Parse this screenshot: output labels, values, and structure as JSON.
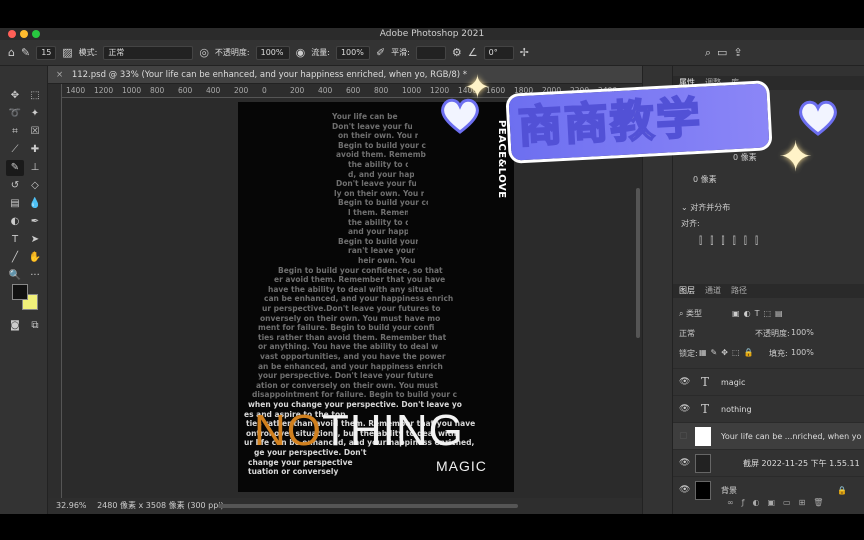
{
  "app": {
    "title": "Adobe Photoshop 2021"
  },
  "options_bar": {
    "brush_size": "15",
    "mode_label": "模式:",
    "mode_value": "正常",
    "opacity_label": "不透明度:",
    "opacity_value": "100%",
    "flow_label": "流量:",
    "flow_value": "100%",
    "smoothing_label": "平滑:",
    "angle_value": "0°"
  },
  "document": {
    "tab_title": "112.psd @ 33% (Your life can be enhanced, and your happiness enriched, when yo, RGB/8) *",
    "ruler_labels": [
      "1400",
      "1200",
      "1000",
      "800",
      "600",
      "400",
      "200",
      "0",
      "200",
      "400",
      "600",
      "800",
      "1000",
      "1200",
      "1400",
      "1600",
      "1800",
      "2000",
      "2200",
      "2400"
    ],
    "zoom": "32.96%",
    "doc_info": "2480 像素 x 3508 像素 (300 ppi)"
  },
  "artwork": {
    "vertical_text": "PEACE&LOVE",
    "headline_highlight": "NO",
    "headline_rest": "THING",
    "subline": "MAGIC",
    "body_lines": [
      "Your life can be",
      "Don't leave your futur",
      "on their own. You mus",
      "Begin to build your con",
      "avoid them. Remember th",
      "the ability to deal",
      "d, and your happine",
      "Don't leave your futu",
      "ly on their own. You mu",
      "Begin to build your con",
      "l them. Remember",
      "the ability to deal",
      "and your happine",
      "Begin to build your c",
      "ran't leave your fu",
      "heir own. You m",
      "Begin to build your confidence, so that ",
      "er avoid them. Remember that you have",
      "have the ability to deal with any situat",
      "can be enhanced, and your happiness enrich",
      "ur perspective.Don't leave your futures to",
      "onversely on their own. You must have mo",
      "ment for failure. Begin to build your confi",
      "ties rather than avoid them. Remember that",
      "or anything. You have the ability to deal w",
      "vast opportunities, and you have the power",
      "an be enhanced, and your happiness enrich",
      "your perspective. Don't leave your future",
      "ation or conversely on their own. You must",
      "disappointment for failure. Begin to build your c",
      "when you change your perspective. Don't leave yo",
      "es and aspire to the top",
      "ties rather than avoid them. Remember that you have",
      "ontrol over situations, but the ability to deal with",
      "ur life can be enhanced, and your happiness enriched,",
      "ge your perspective. Don't",
      "change your perspective",
      "tuation or conversely"
    ]
  },
  "overlay": {
    "title": "商商教学"
  },
  "right_panel": {
    "props_tabs": [
      "属性",
      "调整",
      "库"
    ],
    "props_w": "0 像素",
    "props_h": "0 像素",
    "align_header": "对齐并分布",
    "align_label": "对齐:",
    "layers_tabs": [
      "图层",
      "通道",
      "路径"
    ],
    "filter_kind": "类型",
    "blend_mode": "正常",
    "opacity_label": "不透明度:",
    "opacity_value": "100%",
    "lock_label": "锁定:",
    "fill_label": "填充:",
    "fill_value": "100%",
    "layers": [
      {
        "name": "magic",
        "kind": "T"
      },
      {
        "name": "nothing",
        "kind": "T"
      },
      {
        "name": "Your life can be ...nriched, when yo"
      },
      {
        "name": "截屏 2022-11-25 下午 1.55.11"
      },
      {
        "name": "背景"
      }
    ]
  },
  "colors": {
    "accent_orange": "#d0801f",
    "overlay_purple": "#6d6ff0",
    "foreground": "#111111",
    "background": "#f0f07a"
  }
}
